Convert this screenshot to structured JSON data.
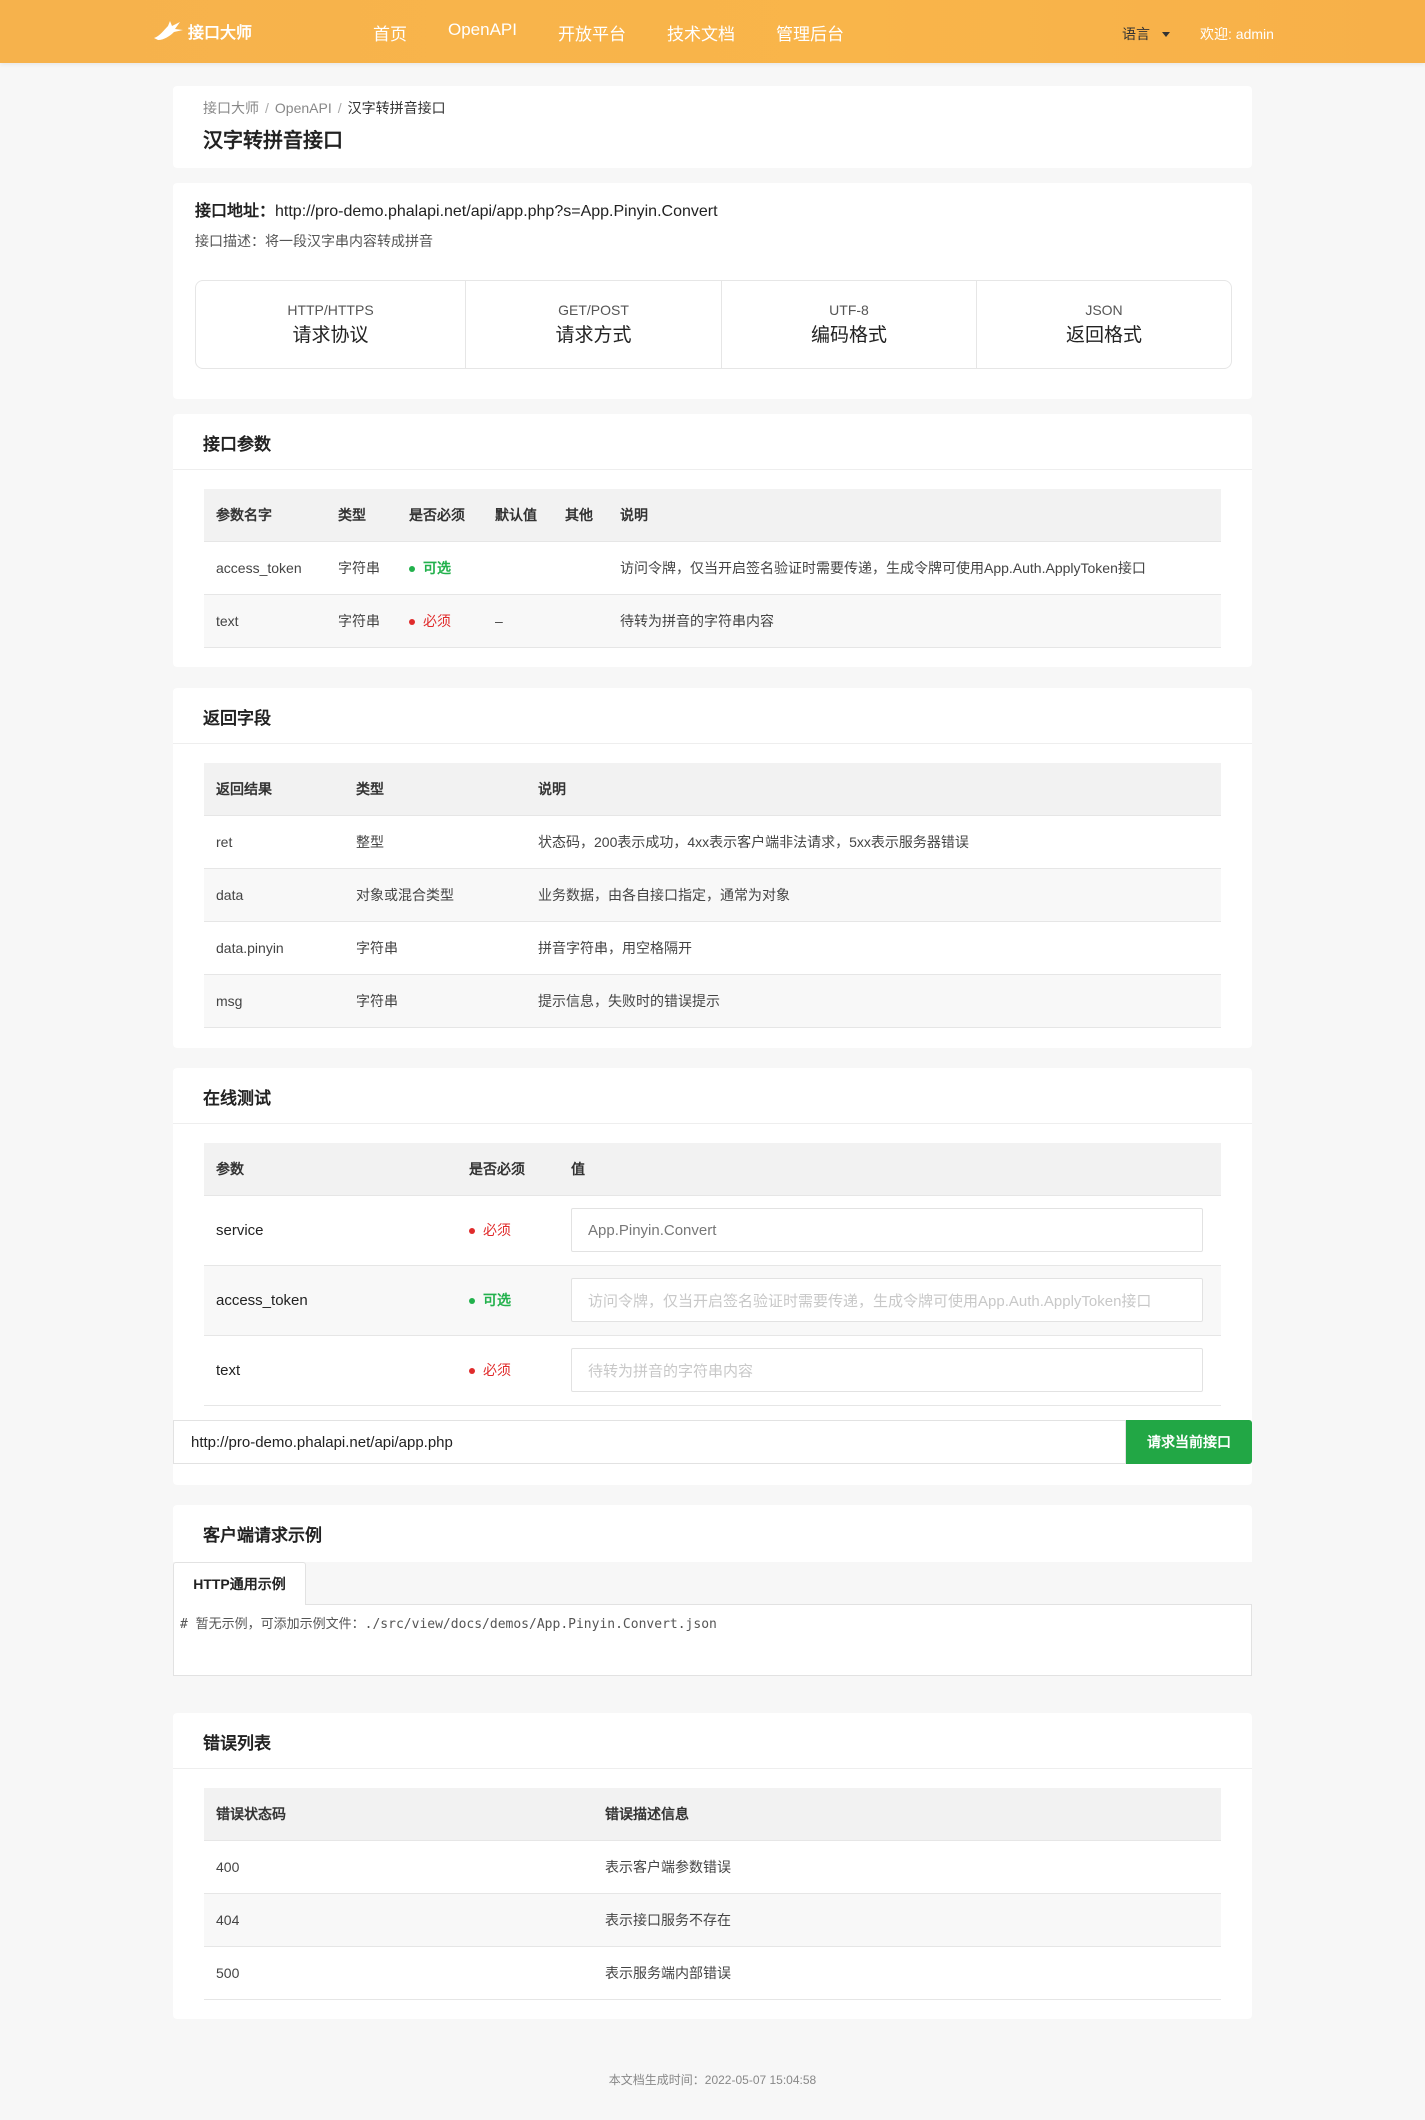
{
  "header": {
    "logo_text": "接口大师",
    "nav": [
      "首页",
      "OpenAPI",
      "开放平台",
      "技术文档",
      "管理后台"
    ],
    "lang_label": "语言",
    "welcome": "欢迎: admin"
  },
  "breadcrumb": {
    "items": [
      "接口大师",
      "OpenAPI"
    ],
    "separator": "/",
    "current": "汉字转拼音接口"
  },
  "page_title": "汉字转拼音接口",
  "api": {
    "url_label": "接口地址：",
    "url": "http://pro-demo.phalapi.net/api/app.php?s=App.Pinyin.Convert",
    "desc_label": "接口描述：",
    "desc": "将一段汉字串内容转成拼音",
    "info": [
      {
        "small": "HTTP/HTTPS",
        "big": "请求协议"
      },
      {
        "small": "GET/POST",
        "big": "请求方式"
      },
      {
        "small": "UTF-8",
        "big": "编码格式"
      },
      {
        "small": "JSON",
        "big": "返回格式"
      }
    ]
  },
  "params": {
    "title": "接口参数",
    "headers": [
      "参数名字",
      "类型",
      "是否必须",
      "默认值",
      "其他",
      "说明"
    ],
    "rows": [
      {
        "name": "access_token",
        "type": "字符串",
        "required": "可选",
        "default": "",
        "other": "",
        "desc": "访问令牌，仅当开启签名验证时需要传递，生成令牌可使用App.Auth.ApplyToken接口"
      },
      {
        "name": "text",
        "type": "字符串",
        "required": "必须",
        "default": "–",
        "other": "",
        "desc": "待转为拼音的字符串内容"
      }
    ]
  },
  "returns": {
    "title": "返回字段",
    "headers": [
      "返回结果",
      "类型",
      "说明"
    ],
    "rows": [
      {
        "name": "ret",
        "type": "整型",
        "desc": "状态码，200表示成功，4xx表示客户端非法请求，5xx表示服务器错误"
      },
      {
        "name": "data",
        "type": "对象或混合类型",
        "desc": "业务数据，由各自接口指定，通常为对象"
      },
      {
        "name": "data.pinyin",
        "type": "字符串",
        "desc": "拼音字符串，用空格隔开"
      },
      {
        "name": "msg",
        "type": "字符串",
        "desc": "提示信息，失败时的错误提示"
      }
    ]
  },
  "test": {
    "title": "在线测试",
    "headers": [
      "参数",
      "是否必须",
      "值"
    ],
    "rows": [
      {
        "name": "service",
        "required": "必须",
        "value": "App.Pinyin.Convert",
        "placeholder": ""
      },
      {
        "name": "access_token",
        "required": "可选",
        "value": "",
        "placeholder": "访问令牌，仅当开启签名验证时需要传递，生成令牌可使用App.Auth.ApplyToken接口"
      },
      {
        "name": "text",
        "required": "必须",
        "value": "",
        "placeholder": "待转为拼音的字符串内容"
      }
    ],
    "request_url": "http://pro-demo.phalapi.net/api/app.php",
    "request_button": "请求当前接口"
  },
  "client_example": {
    "title": "客户端请求示例",
    "tab_label": "HTTP通用示例",
    "code": "# 暂无示例，可添加示例文件：./src/view/docs/demos/App.Pinyin.Convert.json"
  },
  "errors": {
    "title": "错误列表",
    "headers": [
      "错误状态码",
      "错误描述信息"
    ],
    "rows": [
      {
        "code": "400",
        "desc": "表示客户端参数错误"
      },
      {
        "code": "404",
        "desc": "表示接口服务不存在"
      },
      {
        "code": "500",
        "desc": "表示服务端内部错误"
      }
    ]
  },
  "footer": "本文档生成时间：2022-05-07 15:04:58",
  "colors": {
    "header": "#f8b34a",
    "required_red": "#e02b2b",
    "optional_green": "#22b14c",
    "button_green": "#22a745"
  }
}
